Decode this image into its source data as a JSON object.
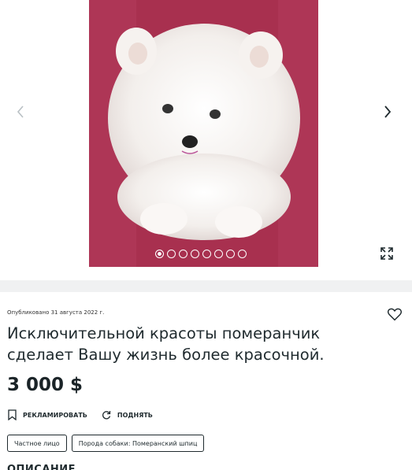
{
  "gallery": {
    "photo_alt": "померанчик",
    "dots": [
      true,
      false,
      false,
      false,
      false,
      false,
      false,
      false
    ],
    "prev_icon": "chevron-left-icon",
    "next_icon": "chevron-right-icon",
    "expand_icon": "expand-icon"
  },
  "ad": {
    "published": "Опубликовано 31 августа 2022 г.",
    "title": "Исключительной красоты померанчик сделает Вашу жизнь более красочной.",
    "price": "3 000 $",
    "favorite_icon": "heart-icon"
  },
  "actions": {
    "report_label": "РЕКЛАМИРОВАТЬ",
    "report_icon": "bookmark-icon",
    "raise_label": "ПОДНЯТЬ",
    "raise_icon": "refresh-icon"
  },
  "tags": [
    "Частное лицо",
    "Порода собаки: Померанский шпиц"
  ],
  "description": {
    "heading": "ОПИСАНИЕ"
  },
  "colors": {
    "photo_bg": "#a32a4c",
    "text": "#1f2a2e",
    "separator": "#f0f1f2"
  }
}
